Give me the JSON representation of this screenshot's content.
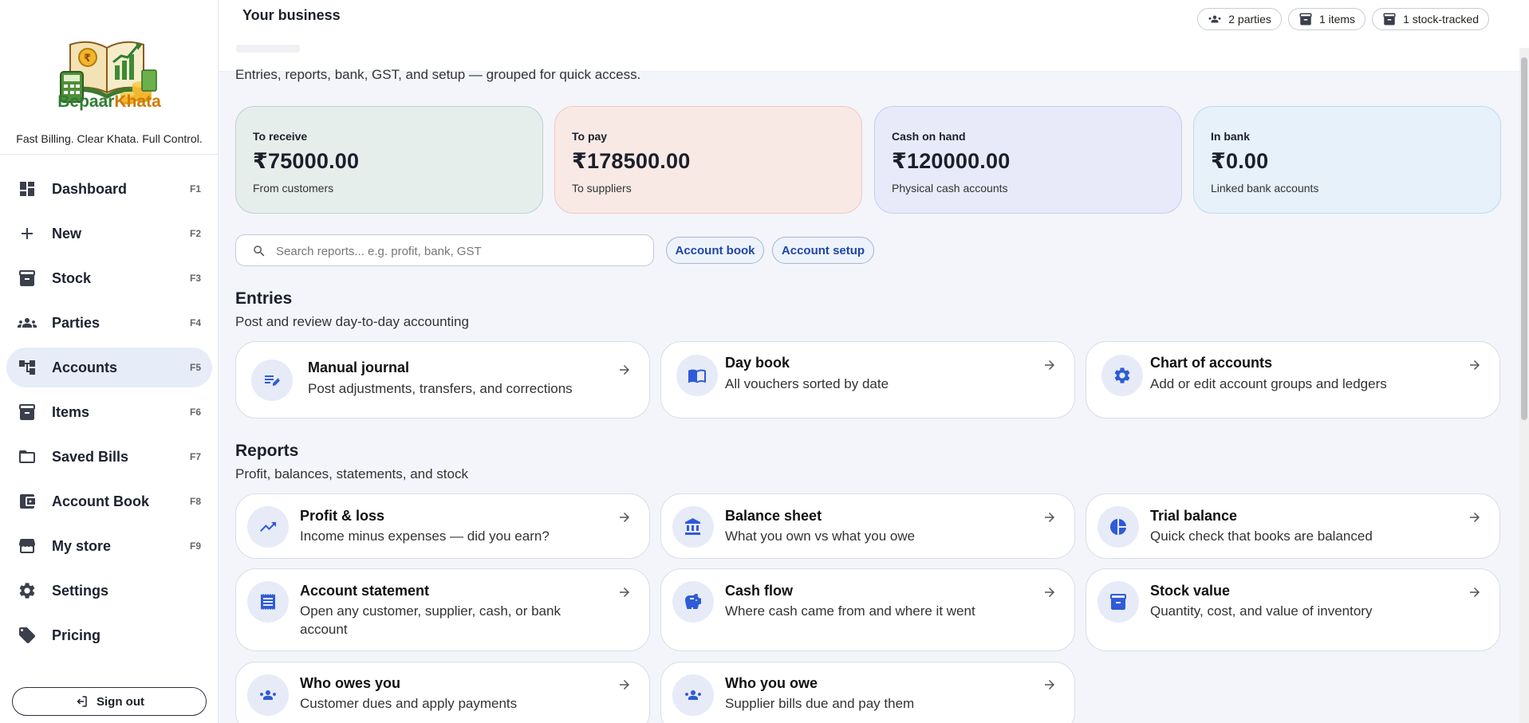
{
  "brand": {
    "name_part1": "Bepaar",
    "name_part2": "Khata",
    "tagline": "Fast Billing. Clear Khata. Full Control."
  },
  "nav": [
    {
      "label": "Dashboard",
      "key": "F1",
      "icon": "dashboard-icon"
    },
    {
      "label": "New",
      "key": "F2",
      "icon": "plus-icon"
    },
    {
      "label": "Stock",
      "key": "F3",
      "icon": "archive-box-icon"
    },
    {
      "label": "Parties",
      "key": "F4",
      "icon": "people-icon"
    },
    {
      "label": "Accounts",
      "key": "F5",
      "icon": "account-tree-icon",
      "active": true
    },
    {
      "label": "Items",
      "key": "F6",
      "icon": "archive-box-icon"
    },
    {
      "label": "Saved Bills",
      "key": "F7",
      "icon": "folder-icon"
    },
    {
      "label": "Account Book",
      "key": "F8",
      "icon": "wallet-icon"
    },
    {
      "label": "My store",
      "key": "F9",
      "icon": "storefront-icon"
    },
    {
      "label": "Settings",
      "key": "",
      "icon": "gear-icon"
    },
    {
      "label": "Pricing",
      "key": "",
      "icon": "tag-icon"
    }
  ],
  "signout_label": "Sign out",
  "header": {
    "title": "Your business",
    "chips": [
      "2 parties",
      "1 items",
      "1 stock-tracked"
    ],
    "subtitle": "Entries, reports, bank, GST, and setup — grouped for quick access."
  },
  "summary": {
    "receive": {
      "label": "To receive",
      "value": "₹75000.00",
      "sub": "From customers"
    },
    "pay": {
      "label": "To pay",
      "value": "₹178500.00",
      "sub": "To suppliers"
    },
    "cash": {
      "label": "Cash on hand",
      "value": "₹120000.00",
      "sub": "Physical cash accounts"
    },
    "bank": {
      "label": "In bank",
      "value": "₹0.00",
      "sub": "Linked bank accounts"
    }
  },
  "search": {
    "placeholder": "Search reports... e.g. profit, bank, GST"
  },
  "pills": {
    "account_book": "Account book",
    "account_setup": "Account setup"
  },
  "entries": {
    "title": "Entries",
    "subtitle": "Post and review day-to-day accounting",
    "cards": [
      {
        "title": "Manual journal",
        "desc": "Post adjustments, transfers, and corrections",
        "icon": "edit-note-icon"
      },
      {
        "title": "Day book",
        "desc": "All vouchers sorted by date",
        "icon": "open-book-icon"
      },
      {
        "title": "Chart of accounts",
        "desc": "Add or edit account groups and ledgers",
        "icon": "gear-icon"
      }
    ]
  },
  "reports": {
    "title": "Reports",
    "subtitle": "Profit, balances, statements, and stock",
    "cards": [
      {
        "title": "Profit & loss",
        "desc": "Income minus expenses — did you earn?",
        "icon": "trending-up-icon"
      },
      {
        "title": "Balance sheet",
        "desc": "What you own vs what you owe",
        "icon": "bank-icon"
      },
      {
        "title": "Trial balance",
        "desc": "Quick check that books are balanced",
        "icon": "pie-chart-icon"
      },
      {
        "title": "Account statement",
        "desc": "Open any customer, supplier, cash, or bank account",
        "icon": "receipt-icon"
      },
      {
        "title": "Cash flow",
        "desc": "Where cash came from and where it went",
        "icon": "piggy-bank-icon"
      },
      {
        "title": "Stock value",
        "desc": "Quantity, cost, and value of inventory",
        "icon": "archive-box-icon"
      },
      {
        "title": "Who owes you",
        "desc": "Customer dues and apply payments",
        "icon": "people-icon"
      },
      {
        "title": "Who you owe",
        "desc": "Supplier bills due and pay them",
        "icon": "people-icon"
      }
    ]
  }
}
